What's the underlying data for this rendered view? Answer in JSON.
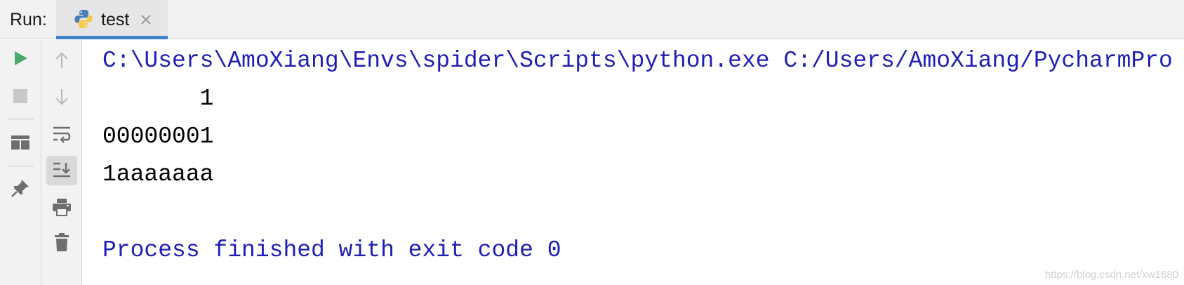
{
  "header": {
    "run_label": "Run:",
    "tab": {
      "label": "test",
      "icon": "python-icon",
      "close_icon": "close-icon",
      "active": true
    }
  },
  "toolbar": {
    "primary": [
      {
        "name": "rerun-button",
        "icon": "play-icon",
        "enabled": true
      },
      {
        "name": "stop-button",
        "icon": "stop-icon",
        "enabled": false
      },
      {
        "name": "layout-button",
        "icon": "layout-icon",
        "enabled": true
      },
      {
        "name": "pin-tab-button",
        "icon": "pin-icon",
        "enabled": true
      }
    ],
    "secondary": [
      {
        "name": "up-stack-button",
        "icon": "arrow-up-icon",
        "enabled": false
      },
      {
        "name": "down-stack-button",
        "icon": "arrow-down-icon",
        "enabled": false
      },
      {
        "name": "soft-wrap-button",
        "icon": "soft-wrap-icon",
        "enabled": true
      },
      {
        "name": "scroll-to-end-button",
        "icon": "scroll-to-end-icon",
        "enabled": true,
        "active": true
      },
      {
        "name": "print-button",
        "icon": "print-icon",
        "enabled": true
      },
      {
        "name": "clear-all-button",
        "icon": "trash-icon",
        "enabled": true
      }
    ]
  },
  "console": {
    "lines": [
      {
        "text": "C:\\Users\\AmoXiang\\Envs\\spider\\Scripts\\python.exe C:/Users/AmoXiang/PycharmPro",
        "kind": "system"
      },
      {
        "text": "       1",
        "kind": "output"
      },
      {
        "text": "00000001",
        "kind": "output"
      },
      {
        "text": "1aaaaaaa",
        "kind": "output"
      },
      {
        "text": "",
        "kind": "output"
      },
      {
        "text": "Process finished with exit code 0",
        "kind": "system"
      }
    ]
  },
  "watermark": "https://blog.csdn.net/xw1680",
  "colors": {
    "system_text": "#1f1fb4",
    "output_text": "#000000",
    "tab_underline": "#4083c9",
    "play_green": "#4ba96b",
    "panel_bg": "#f2f2f2"
  }
}
